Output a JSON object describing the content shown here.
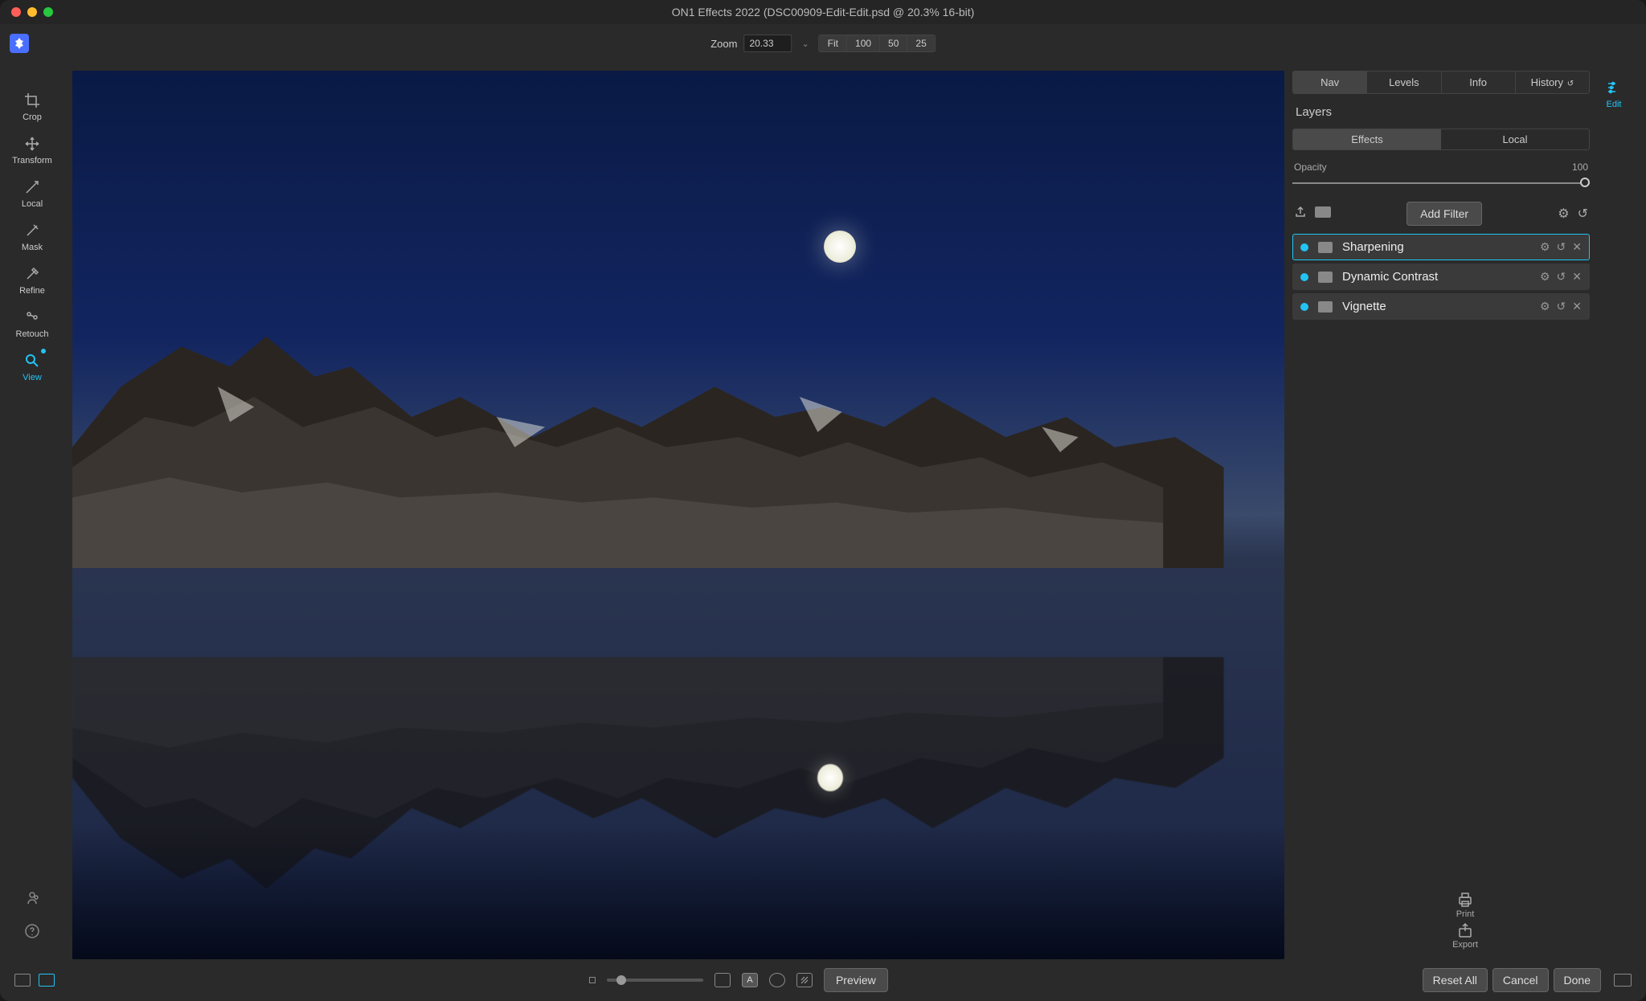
{
  "title": "ON1 Effects 2022 (DSC00909-Edit-Edit.psd @ 20.3% 16-bit)",
  "zoom": {
    "label": "Zoom",
    "value": "20.33",
    "presets": [
      "Fit",
      "100",
      "50",
      "25"
    ]
  },
  "left_tools": [
    {
      "name": "Crop"
    },
    {
      "name": "Transform"
    },
    {
      "name": "Local"
    },
    {
      "name": "Mask"
    },
    {
      "name": "Refine"
    },
    {
      "name": "Retouch"
    },
    {
      "name": "View"
    }
  ],
  "right_tool": {
    "name": "Edit"
  },
  "tabs": [
    "Nav",
    "Levels",
    "Info",
    "History"
  ],
  "panel_title": "Layers",
  "subtabs": [
    "Effects",
    "Local"
  ],
  "opacity": {
    "label": "Opacity",
    "value": "100"
  },
  "add_filter": "Add Filter",
  "filters": [
    {
      "name": "Sharpening",
      "selected": true
    },
    {
      "name": "Dynamic Contrast",
      "selected": false
    },
    {
      "name": "Vignette",
      "selected": false
    }
  ],
  "rbottom": [
    {
      "name": "Print"
    },
    {
      "name": "Export"
    }
  ],
  "footer": {
    "preview": "Preview",
    "reset": "Reset All",
    "cancel": "Cancel",
    "done": "Done"
  }
}
